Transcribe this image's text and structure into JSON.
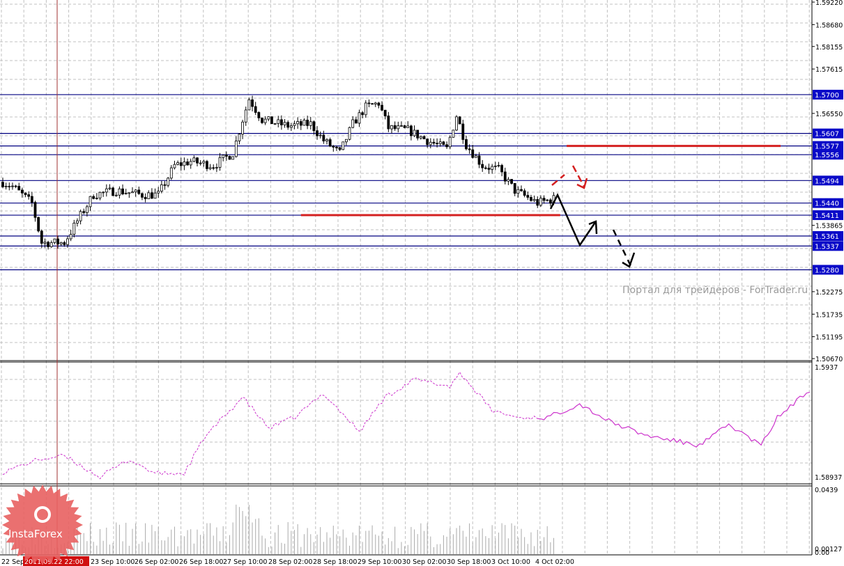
{
  "chart_data": {
    "type": "candlestick",
    "price_axis": {
      "ticks": [
        "1.59220",
        "1.58680",
        "1.58155",
        "1.57615",
        "1.56550",
        "1.53865",
        "1.52275",
        "1.51735",
        "1.51195",
        "1.50670"
      ],
      "range": [
        1.5067,
        1.5922
      ]
    },
    "levels": [
      {
        "label": "1.5700",
        "value": 1.57
      },
      {
        "label": "1.5607",
        "value": 1.5607
      },
      {
        "label": "1.5577",
        "value": 1.5577
      },
      {
        "label": "1.5556",
        "value": 1.5556
      },
      {
        "label": "1.5494",
        "value": 1.5494
      },
      {
        "label": "1.5440",
        "value": 1.544
      },
      {
        "label": "1.5411",
        "value": 1.5411
      },
      {
        "label": "1.5361",
        "value": 1.5361
      },
      {
        "label": "1.5337",
        "value": 1.5337
      },
      {
        "label": "1.5280",
        "value": 1.528
      }
    ],
    "red_levels": [
      {
        "value": 1.5577,
        "from": 174,
        "to": 240
      },
      {
        "value": 1.5411,
        "from": 92,
        "to": 172
      }
    ],
    "close_keypoints": [
      [
        0,
        1.549
      ],
      [
        3,
        1.548
      ],
      [
        9,
        1.544
      ],
      [
        12,
        1.5345
      ],
      [
        19,
        1.5345
      ],
      [
        24,
        1.541
      ],
      [
        28,
        1.546
      ],
      [
        35,
        1.547
      ],
      [
        43,
        1.546
      ],
      [
        48,
        1.546
      ],
      [
        53,
        1.553
      ],
      [
        58,
        1.554
      ],
      [
        65,
        1.553
      ],
      [
        71,
        1.556
      ],
      [
        74,
        1.564
      ],
      [
        76,
        1.569
      ],
      [
        80,
        1.564
      ],
      [
        88,
        1.5625
      ],
      [
        95,
        1.563
      ],
      [
        99,
        1.559
      ],
      [
        104,
        1.556
      ],
      [
        108,
        1.563
      ],
      [
        112,
        1.567
      ],
      [
        116,
        1.568
      ],
      [
        119,
        1.562
      ],
      [
        125,
        1.5615
      ],
      [
        131,
        1.559
      ],
      [
        137,
        1.557
      ],
      [
        140,
        1.565
      ],
      [
        143,
        1.558
      ],
      [
        148,
        1.553
      ],
      [
        153,
        1.552
      ],
      [
        158,
        1.547
      ],
      [
        165,
        1.544
      ],
      [
        170,
        1.545
      ]
    ],
    "indicator": {
      "axis": [
        "1.5937",
        "1.58937"
      ],
      "range": [
        1.58937,
        1.5937
      ],
      "dashed_until": 165,
      "keypoints": [
        [
          0,
          1.58973
        ],
        [
          11,
          1.5902
        ],
        [
          19,
          1.59033
        ],
        [
          30,
          1.58955
        ],
        [
          39,
          1.5902
        ],
        [
          47,
          1.58968
        ],
        [
          56,
          1.58968
        ],
        [
          62,
          1.59098
        ],
        [
          74,
          1.59253
        ],
        [
          82,
          1.59137
        ],
        [
          90,
          1.59176
        ],
        [
          99,
          1.59266
        ],
        [
          110,
          1.59124
        ],
        [
          118,
          1.59253
        ],
        [
          127,
          1.59318
        ],
        [
          138,
          1.59292
        ],
        [
          141,
          1.59344
        ],
        [
          151,
          1.59202
        ],
        [
          159,
          1.59176
        ],
        [
          168,
          1.59176
        ],
        [
          178,
          1.59227
        ],
        [
          187,
          1.59163
        ],
        [
          198,
          1.59111
        ],
        [
          215,
          1.59072
        ],
        [
          224,
          1.5915
        ],
        [
          234,
          1.59072
        ],
        [
          239,
          1.59176
        ],
        [
          249,
          1.59279
        ]
      ]
    },
    "volume": {
      "axis": [
        "0.0439",
        "0.00127",
        "0.00"
      ],
      "range": [
        0,
        0.0439
      ]
    },
    "time_labels": [
      "22 Sep",
      "2011.09.22 22:00",
      "23 Sep 10:00",
      "26 Sep 02:00",
      "26 Sep 18:00",
      "27 Sep 10:00",
      "28 Sep 02:00",
      "28 Sep 18:00",
      "29 Sep 10:00",
      "30 Sep 02:00",
      "30 Sep 18:00",
      "3 Oct 10:00",
      "4 Oct 02:00"
    ],
    "colors": {
      "level": "#000080",
      "red": "#d42020",
      "grid": "#c0c0c0",
      "indicator": "#cc33cc",
      "cursor": "#a03030"
    }
  },
  "watermark": "Портал для трейдеров - ForTrader.ru",
  "logo": "InstaForex"
}
